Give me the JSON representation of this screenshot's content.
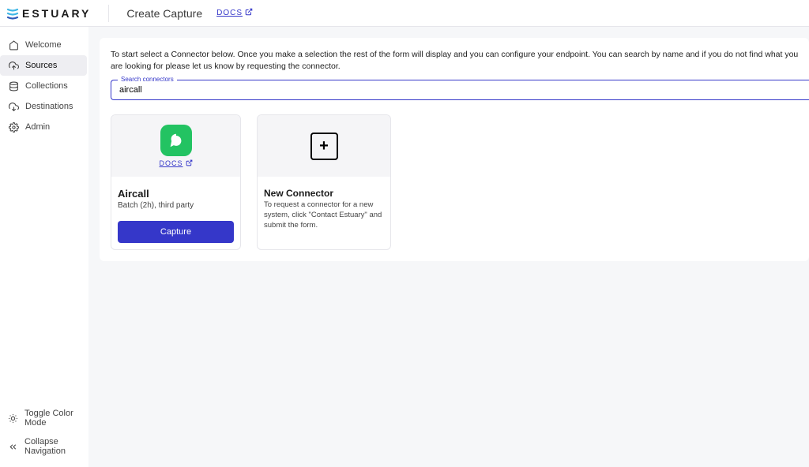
{
  "header": {
    "logo_text": "ESTUARY",
    "page_title": "Create Capture",
    "docs_label": "DOCS"
  },
  "sidebar": {
    "items": [
      {
        "label": "Welcome"
      },
      {
        "label": "Sources"
      },
      {
        "label": "Collections"
      },
      {
        "label": "Destinations"
      },
      {
        "label": "Admin"
      }
    ],
    "bottom": [
      {
        "label": "Toggle Color Mode"
      },
      {
        "label": "Collapse Navigation"
      }
    ]
  },
  "content": {
    "intro": "To start select a Connector below. Once you make a selection the rest of the form will display and you can configure your endpoint. You can search by name and if you do not find what you are looking for please let us know by requesting the connector.",
    "search_label": "Search connectors",
    "search_value": "aircall"
  },
  "connector_card": {
    "docs_label": "DOCS",
    "title": "Aircall",
    "subtitle": "Batch (2h), third party",
    "button": "Capture"
  },
  "new_card": {
    "title": "New Connector",
    "subtitle": "To request a connector for a new system, click \"Contact Estuary\" and submit the form."
  }
}
